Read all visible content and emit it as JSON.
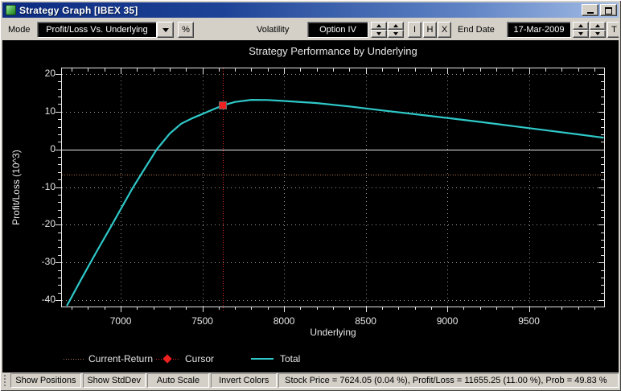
{
  "window": {
    "title": "Strategy Graph [IBEX 35]"
  },
  "icons": {
    "app_icon": "green-app-cube",
    "minimize_icon": "_",
    "maximize_icon": "□",
    "dropdown_icon": "▼",
    "spinner_up_icon": "▲",
    "spinner_down_icon": "▼",
    "cursor_icon": "◆"
  },
  "toolbar": {
    "mode_label": "Mode",
    "mode_value": "Profit/Loss Vs. Underlying",
    "percent_label": "%",
    "volatility_label": "Volatility",
    "volatility_value": "Option IV",
    "button_i": "I",
    "button_h": "H",
    "button_x": "X",
    "end_date_label": "End Date",
    "end_date_value": "17-Mar-2009",
    "button_t": "T"
  },
  "chart_data": {
    "type": "line",
    "title": "Strategy Performance by Underlying",
    "xlabel": "Underlying",
    "ylabel": "Profit/Loss (10^3)",
    "xlim": [
      6640,
      9960
    ],
    "ylim": [
      -41.7,
      21.5
    ],
    "x_ticks": [
      7000,
      7500,
      8000,
      8500,
      9000,
      9500
    ],
    "y_ticks": [
      20,
      10,
      0,
      -10,
      -20,
      -30,
      -40
    ],
    "x_minor_step": 100,
    "y_minor_step": 2,
    "grid": true,
    "legend_position": "bottom",
    "background": "#000000",
    "series": [
      {
        "name": "Total",
        "color": "#2fc8c8",
        "points": [
          [
            6670,
            -41.5
          ],
          [
            6760,
            -34.3
          ],
          [
            6850,
            -27.3
          ],
          [
            6940,
            -20.5
          ],
          [
            7010,
            -15.1
          ],
          [
            7075,
            -10.1
          ],
          [
            7150,
            -4.9
          ],
          [
            7221,
            0.0
          ],
          [
            7300,
            4.2
          ],
          [
            7370,
            6.8
          ],
          [
            7440,
            8.3
          ],
          [
            7500,
            9.4
          ],
          [
            7560,
            10.5
          ],
          [
            7624,
            11.66
          ],
          [
            7700,
            12.6
          ],
          [
            7800,
            13.15
          ],
          [
            7900,
            13.1
          ],
          [
            8000,
            12.85
          ],
          [
            8200,
            12.3
          ],
          [
            8400,
            11.4
          ],
          [
            8600,
            10.35
          ],
          [
            8800,
            9.35
          ],
          [
            9000,
            8.35
          ],
          [
            9200,
            7.3
          ],
          [
            9400,
            6.2
          ],
          [
            9600,
            5.1
          ],
          [
            9800,
            4.0
          ],
          [
            9958,
            3.1
          ]
        ]
      }
    ],
    "current_return_y": -6.6,
    "current_return_color": "#c07a48",
    "cursor": {
      "x": 7624.05,
      "y": 11.655,
      "color": "#ee2020"
    },
    "legend": [
      {
        "label": "Current-Return"
      },
      {
        "label": "Cursor"
      },
      {
        "label": "Total"
      }
    ]
  },
  "status_bar": {
    "items": [
      "Show Positions",
      "Show StdDev",
      "Auto Scale",
      "Invert Colors"
    ],
    "summary": "Stock Price = 7624.05 (0.04 %), Profit/Loss = 11655.25 (11.00 %), Prob = 49.83 %"
  }
}
